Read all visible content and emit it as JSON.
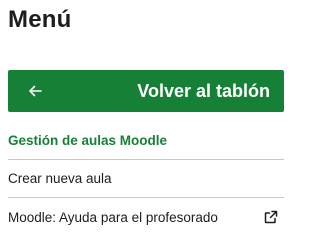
{
  "menu": {
    "title": "Menú",
    "back_button": {
      "icon": "arrow-left-icon",
      "label": "Volver al tablón"
    },
    "items": [
      {
        "label": "Gestión de aulas Moodle",
        "active": true
      },
      {
        "label": "Crear nueva aula",
        "active": false
      },
      {
        "label": "Moodle: Ayuda para el profesorado",
        "active": false,
        "icon": "external-link-icon"
      }
    ]
  },
  "colors": {
    "accent": "#168136",
    "text": "#1d1d1d",
    "divider": "#c9c9c9",
    "background": "#ffffff"
  }
}
